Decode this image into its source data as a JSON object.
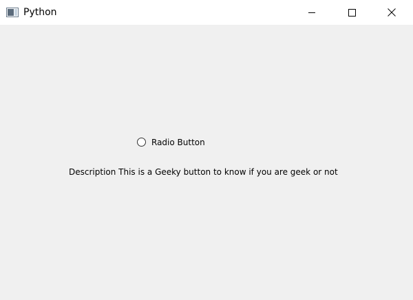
{
  "window": {
    "title": "Python",
    "app_icon": "python-window-icon",
    "controls": {
      "minimize_icon": "minimize-icon",
      "maximize_icon": "maximize-icon",
      "close_icon": "close-icon"
    },
    "background_color": "#f0f0f0",
    "titlebar_color": "#ffffff"
  },
  "content": {
    "radio_button": {
      "label": "Radio Button",
      "checked": false
    },
    "description": "Description This is a Geeky button to know if you are geek or not"
  }
}
